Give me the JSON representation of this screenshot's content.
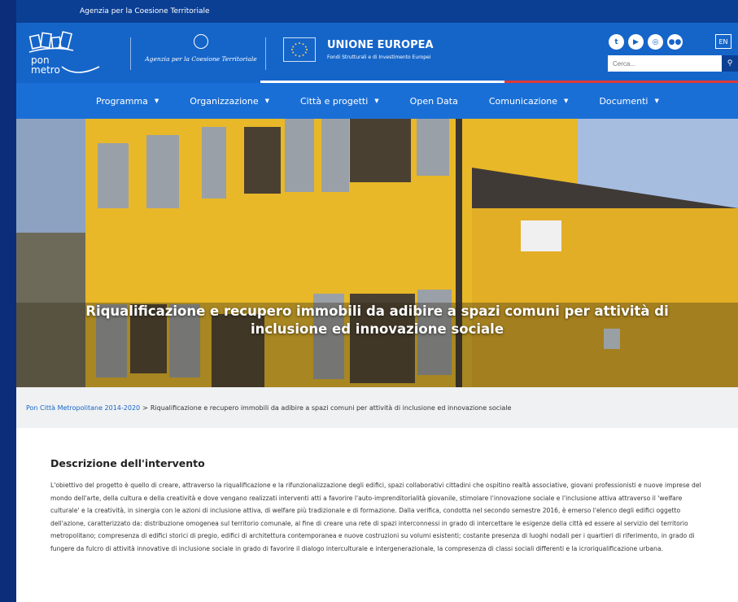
{
  "topbar": {
    "label": "Agenzia per la Coesione Territoriale"
  },
  "header": {
    "logo_text": [
      "pon",
      "metro"
    ],
    "agency_name": "Agenzia per la Coesione Territoriale",
    "eu_title": "UNIONE EUROPEA",
    "eu_subtitle": "Fondi Strutturali e di Investimento Europei",
    "social_icons": [
      "twitter-icon",
      "youtube-icon",
      "instagram-icon",
      "flickr-icon"
    ],
    "lang": "EN",
    "search_placeholder": "Cerca...",
    "stripe_colors": [
      "#1565c9",
      "#ffffff",
      "#e03a3a"
    ]
  },
  "nav": {
    "items": [
      {
        "label": "Programma",
        "dropdown": true
      },
      {
        "label": "Organizzazione",
        "dropdown": true
      },
      {
        "label": "Città e progetti",
        "dropdown": true
      },
      {
        "label": "Open Data",
        "dropdown": false
      },
      {
        "label": "Comunicazione",
        "dropdown": true
      },
      {
        "label": "Documenti",
        "dropdown": true
      }
    ]
  },
  "hero": {
    "title": "Riqualificazione e recupero immobili da adibire a spazi comuni per attività di inclusione ed innovazione sociale"
  },
  "breadcrumb": {
    "home": "Pon Città Metropolitane 2014-2020",
    "separator": ">",
    "current": "Riqualificazione e recupero immobili da adibire a spazi comuni per attività di inclusione ed innovazione sociale"
  },
  "content": {
    "section_title": "Descrizione dell'intervento",
    "description": "L'obiettivo del progetto è quello di creare, attraverso la riqualificazione e la rifunzionalizzazione degli edifici, spazi collaborativi cittadini che ospitino realtà associative, giovani professionisti e nuove imprese del mondo dell'arte, della cultura e della creatività e dove vengano realizzati interventi atti a favorire l'auto-imprenditorialità giovanile, stimolare l'innovazione sociale e l'inclusione attiva attraverso il 'welfare culturale' e la creatività, in sinergia con le azioni di inclusione attiva, di welfare più tradizionale e di formazione. Dalla verifica, condotta nel secondo semestre 2016, è emerso l'elenco degli edifici oggetto dell'azione, caratterizzato da: distribuzione omogenea sul territorio comunale, al fine di creare una rete di spazi interconnessi in grado di intercettare le esigenze della città ed essere al servizio del territorio metropolitano; compresenza di edifici storici di pregio, edifici di architettura contemporanea e nuove costruzioni su volumi esistenti; costante presenza di luoghi nodali per i quartieri di riferimento, in grado di fungere da fulcro di attività innovative di inclusione sociale in grado di favorire il dialogo interculturale e intergenerazionale, la compresenza di classi sociali differenti e la icroriqualificazione urbana."
  }
}
